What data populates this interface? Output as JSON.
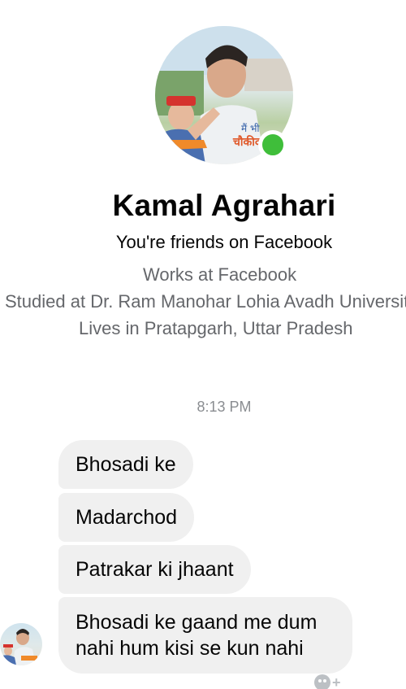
{
  "profile": {
    "name": "Kamal Agrahari",
    "relationship": "You're friends on Facebook",
    "work": "Works at Facebook",
    "education": "Studied at Dr. Ram Manohar Lohia Avadh University",
    "location": "Lives in Pratapgarh, Uttar Pradesh",
    "online": true,
    "photo_caption": [
      "मैं भी",
      "चौकीदार"
    ]
  },
  "conversation": {
    "timestamp": "8:13 PM",
    "messages": [
      {
        "text": "Bhosadi ke"
      },
      {
        "text": "Madarchod"
      },
      {
        "text": "Patrakar ki jhaant"
      },
      {
        "text": "Bhosadi ke gaand me dum nahi hum kisi se kun nahi"
      }
    ]
  },
  "colors": {
    "bubble": "#f0f0f0",
    "online": "#3fbe3a",
    "secondary_text": "#65676b"
  },
  "icons": {
    "online": "online-status-dot-icon",
    "react": "add-reaction-icon"
  }
}
